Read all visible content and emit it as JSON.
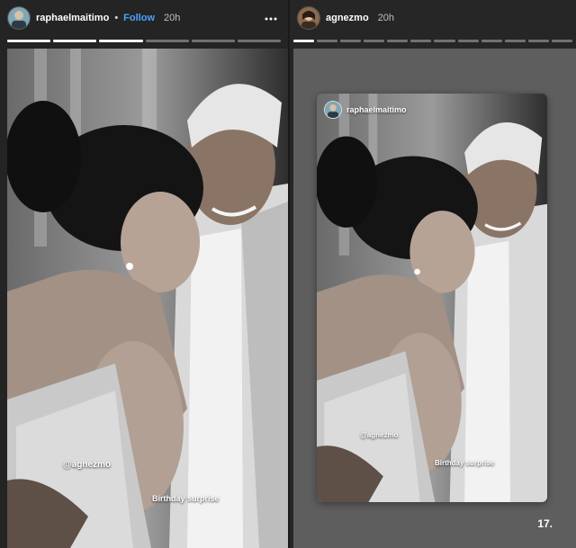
{
  "left_story": {
    "username": "raphaelmaitimo",
    "separator": "•",
    "follow_label": "Follow",
    "time": "20h",
    "mention": "@agnezmo",
    "caption": "Birthday surprise",
    "progress": {
      "segments": 6,
      "completed": 3
    }
  },
  "right_story": {
    "username": "agnezmo",
    "time": "20h",
    "embedded_username": "raphaelmaitimo",
    "mention": "@agnezmo",
    "caption": "Birthday surprise",
    "progress": {
      "segments": 12,
      "completed": 1
    },
    "page_number": "17."
  },
  "icons": {
    "more": "more-horizontal-icon"
  },
  "colors": {
    "follow": "#4aa3ff",
    "background": "#1a1a1a"
  }
}
